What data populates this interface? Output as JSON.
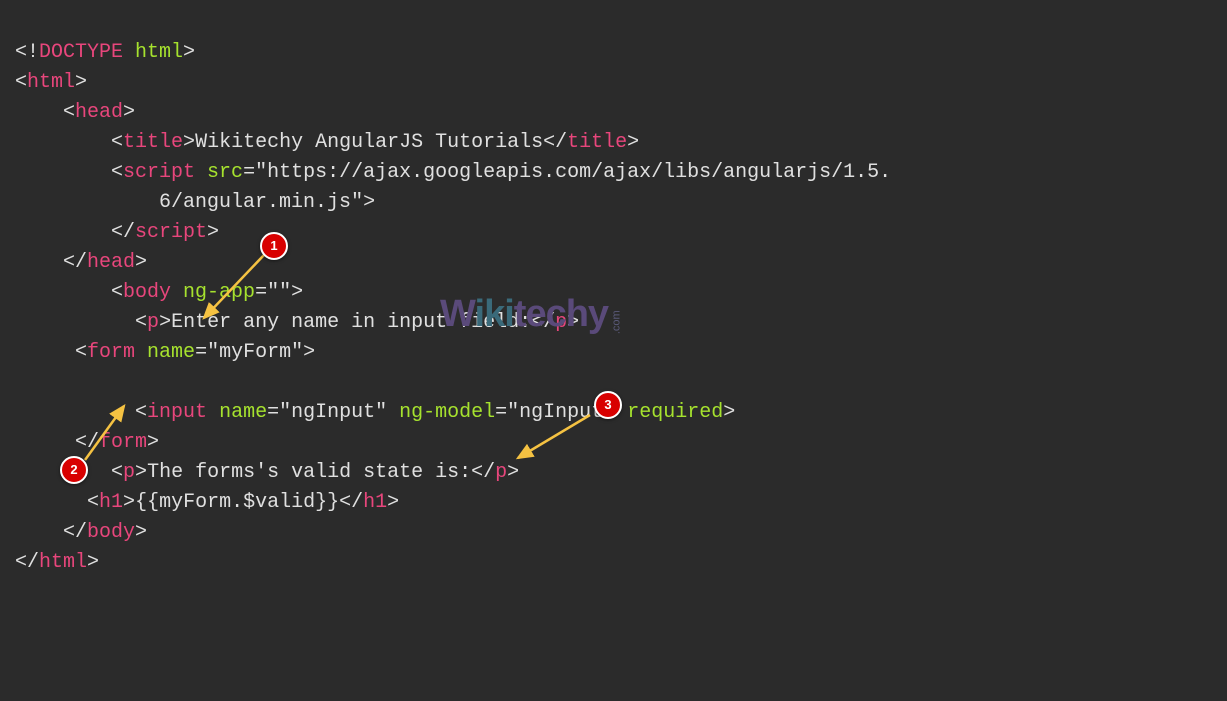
{
  "code": {
    "l1_doctype_open": "<!",
    "l1_doctype_tag": "DOCTYPE",
    "l1_doctype_attr": " html",
    "l1_doctype_close": ">",
    "l2_open": "<",
    "l2_tag": "html",
    "l2_close": ">",
    "l3_open": "<",
    "l3_tag": "head",
    "l3_close": ">",
    "l4_open": "<",
    "l4_tag": "title",
    "l4_close": ">",
    "l4_text": "Wikitechy AngularJS Tutorials",
    "l4_cOpen": "</",
    "l4_cTag": "title",
    "l4_cClose": ">",
    "l5_open": "<",
    "l5_tag": "script",
    "l5_attr": " src",
    "l5_eq": "=",
    "l5_val": "\"https://ajax.googleapis.com/ajax/libs/angularjs/1.5.",
    "l6_text": "6/angular.min.js\"",
    "l6_close": ">",
    "l7_open": "</",
    "l7_tag": "script",
    "l7_close": ">",
    "l8_open": "</",
    "l8_tag": "head",
    "l8_close": ">",
    "l9_open": "<",
    "l9_tag": "body",
    "l9_attr": " ng-app",
    "l9_eq": "=",
    "l9_val": "\"\"",
    "l9_close": ">",
    "l10_open": "<",
    "l10_tag": "p",
    "l10_close": ">",
    "l10_text": "Enter any name in input field:",
    "l10_cOpen": "</",
    "l10_cTag": "p",
    "l10_cClose": ">",
    "l11_open": "<",
    "l11_tag": "form",
    "l11_attr": " name",
    "l11_eq": "=",
    "l11_val": "\"myForm\"",
    "l11_close": ">",
    "l13_open": "<",
    "l13_tag": "input",
    "l13_attr1": " name",
    "l13_eq1": "=",
    "l13_val1": "\"ngInput\"",
    "l13_attr2": " ng-model",
    "l13_eq2": "=",
    "l13_val2": "\"ngInput\"",
    "l13_attr3": " required",
    "l13_close": ">",
    "l14_open": "</",
    "l14_tag": "form",
    "l14_close": ">",
    "l15_open": "<",
    "l15_tag": "p",
    "l15_close": ">",
    "l15_text": "The forms's valid state is:",
    "l15_cOpen": "</",
    "l15_cTag": "p",
    "l15_cClose": ">",
    "l16_open": "<",
    "l16_tag": "h1",
    "l16_close": ">",
    "l16_text": "{{myForm.$valid}}",
    "l16_cOpen": "</",
    "l16_cTag": "h1",
    "l16_cClose": ">",
    "l17_open": "</",
    "l17_tag": "body",
    "l17_close": ">",
    "l18_open": "</",
    "l18_tag": "html",
    "l18_close": ">"
  },
  "annotations": {
    "badge1": "1",
    "badge2": "2",
    "badge3": "3"
  },
  "watermark": {
    "part1": "W",
    "part2": "iki",
    "part3": "techy",
    "com": ".com"
  }
}
